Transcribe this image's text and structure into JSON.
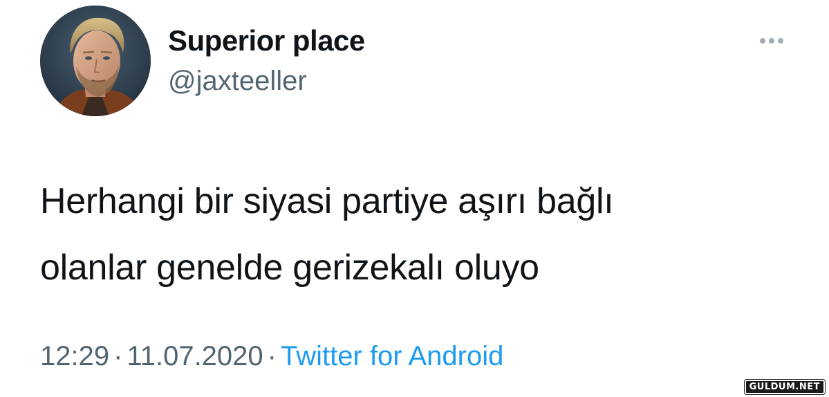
{
  "tweet": {
    "author": {
      "display_name": "Superior place",
      "handle": "@jaxteeller",
      "avatar_icon": "profile-photo"
    },
    "more_icon": "more-horizontal-icon",
    "text_lines": [
      "Herhangi bir siyasi partiye aşırı bağlı",
      "olanlar genelde gerizekalı oluyo"
    ],
    "time": "12:29",
    "separator": "·",
    "date": "11.07.2020",
    "source": "Twitter for Android"
  },
  "watermark": {
    "text": "GULDUM.NET"
  },
  "colors": {
    "text_primary": "#0f1419",
    "text_secondary": "#536471",
    "link": "#1d9bf0",
    "background": "#ffffff"
  }
}
